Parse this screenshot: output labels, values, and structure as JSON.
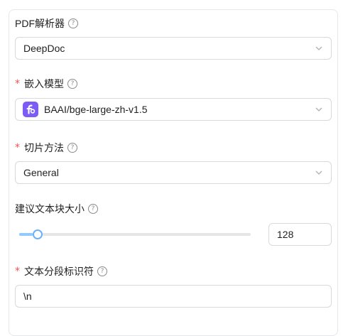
{
  "pdf_parser": {
    "label": "PDF解析器",
    "value": "DeepDoc"
  },
  "embedding_model": {
    "label": "嵌入模型",
    "required": "*",
    "value": "BAAI/bge-large-zh-v1.5",
    "logo_color": "#7b5cf5"
  },
  "chunk_method": {
    "label": "切片方法",
    "required": "*",
    "value": "General"
  },
  "chunk_size": {
    "label": "建议文本块大小",
    "value": "128",
    "slider_fraction": 0.04
  },
  "delimiter": {
    "label": "文本分段标识符",
    "required": "*",
    "value": "\\n"
  },
  "icons": {
    "help": "question-circle-icon",
    "dropdown": "chevron-down-icon"
  },
  "colors": {
    "required": "#ff4d4f",
    "slider_fill": "#91caff",
    "slider_handle": "#69b1ff",
    "border": "#d9d9d9"
  }
}
